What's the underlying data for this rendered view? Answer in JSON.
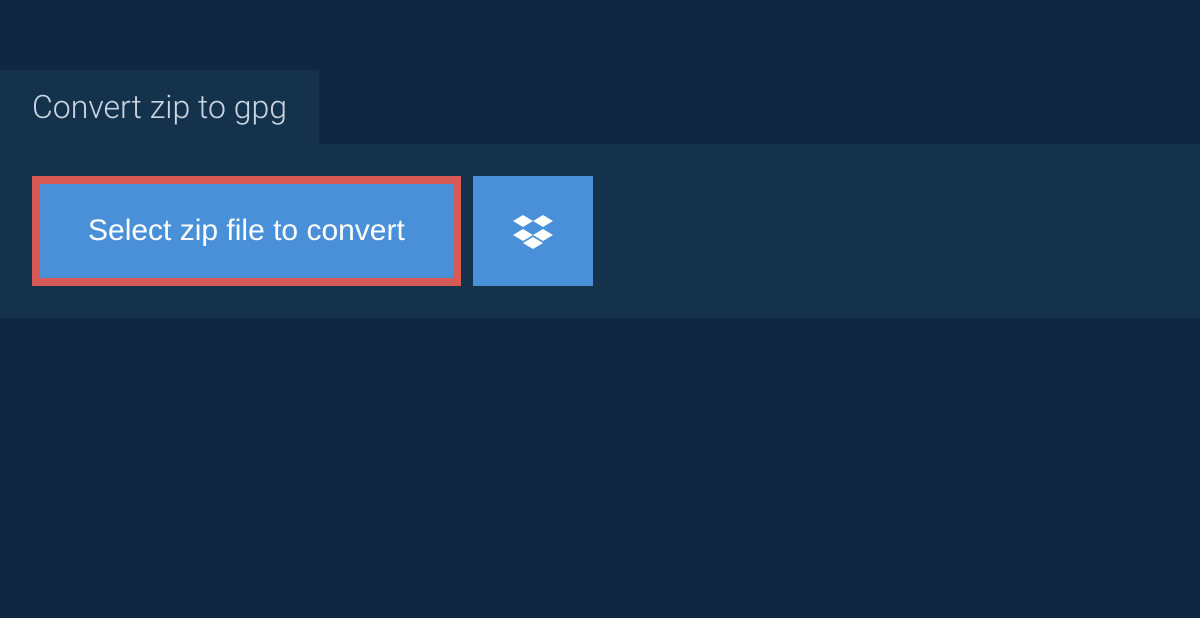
{
  "tab": {
    "label": "Convert zip to gpg"
  },
  "actions": {
    "select_file_label": "Select zip file to convert",
    "dropbox_icon": "dropbox"
  },
  "colors": {
    "highlight_border": "#d85a56",
    "button_bg": "#4a90d9",
    "panel_bg": "#15324c",
    "dark_bg": "#0f2740"
  }
}
